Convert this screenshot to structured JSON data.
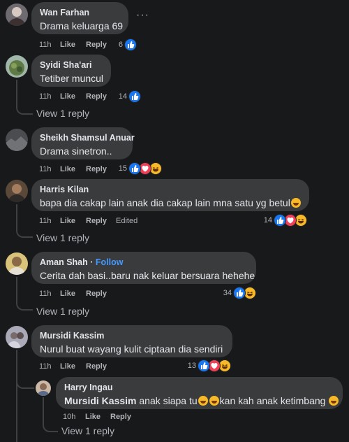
{
  "comments": [
    {
      "name": "Wan Farhan",
      "text": "Drama keluarga 69",
      "time": "11h",
      "like": "Like",
      "reply": "Reply",
      "count": "6"
    },
    {
      "name": "Syidi Sha'ari",
      "text": "Tetiber muncul",
      "time": "11h",
      "like": "Like",
      "reply": "Reply",
      "count": "14",
      "view_replies": "View 1 reply"
    },
    {
      "name": "Sheikh Shamsul Anuar",
      "text": "Drama sinetron..",
      "time": "11h",
      "like": "Like",
      "reply": "Reply",
      "count": "15"
    },
    {
      "name": "Harris Kilan",
      "text": "bapa dia cakap lain anak dia cakap lain mna satu yg betul",
      "time": "11h",
      "like": "Like",
      "reply": "Reply",
      "edited": "Edited",
      "count": "14",
      "view_replies": "View 1 reply"
    },
    {
      "name": "Aman Shah",
      "follow": "Follow",
      "text": "Cerita dah basi..baru nak keluar bersuara hehehe",
      "time": "11h",
      "like": "Like",
      "reply": "Reply",
      "count": "34",
      "view_replies": "View 1 reply"
    },
    {
      "name": "Mursidi Kassim",
      "text": "Nurul buat wayang kulit ciptaan dia sendiri",
      "time": "11h",
      "like": "Like",
      "reply": "Reply",
      "count": "13"
    }
  ],
  "reply": {
    "name": "Harry Ingau",
    "mention": "Mursidi Kassim",
    "text_a": " anak siapa tu",
    "text_b": "kan kah anak ketimbang ",
    "time": "10h",
    "like": "Like",
    "reply": "Reply",
    "view_replies": "View 1 reply"
  },
  "icons": {
    "more": "more-options-icon",
    "like": "like-reaction-icon",
    "love": "love-reaction-icon",
    "haha": "haha-reaction-icon",
    "laugh": "rolling-laughing-emoji"
  },
  "colors": {
    "background": "#18191a",
    "bubble": "#3a3b3c",
    "like": "#1877f2",
    "love": "#f33e58",
    "haha": "#f7b928",
    "link": "#4599ff"
  }
}
